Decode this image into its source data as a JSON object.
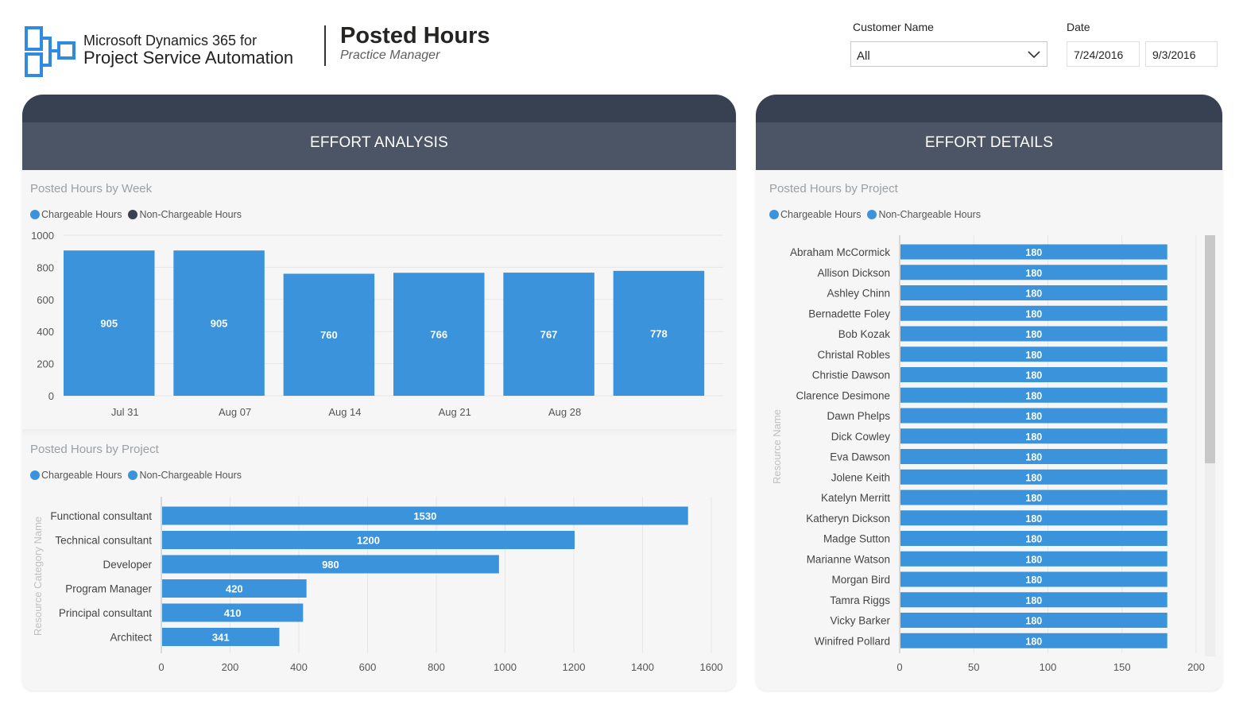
{
  "brand": {
    "line1": "Microsoft Dynamics 365 for",
    "line2": "Project Service Automation"
  },
  "header": {
    "title": "Posted Hours",
    "subtitle": "Practice Manager"
  },
  "filters": {
    "customer_label": "Customer Name",
    "customer_value": "All",
    "date_label": "Date",
    "date_start": "7/24/2016",
    "date_end": "9/3/2016"
  },
  "colors": {
    "chargeable": "#3b93dc",
    "non_chargeable_week": "#374151",
    "non_chargeable_project": "#3b93dc",
    "band_dark": "#374151",
    "band": "#4b5566"
  },
  "panels": {
    "left": {
      "title": "EFFORT ANALYSIS"
    },
    "right": {
      "title": "EFFORT DETAILS"
    }
  },
  "legend": {
    "chargeable": "Chargeable Hours",
    "non_chargeable": "Non-Chargeable Hours"
  },
  "chart_data": [
    {
      "type": "bar",
      "title": "Posted Hours by Week",
      "categories": [
        "Jul 31",
        "Aug 07",
        "Aug 14",
        "Aug 21",
        "Aug 28",
        ""
      ],
      "series": [
        {
          "name": "Chargeable Hours",
          "values": [
            905,
            905,
            760,
            766,
            767,
            778
          ]
        },
        {
          "name": "Non-Chargeable Hours",
          "values": [
            0,
            0,
            0,
            0,
            0,
            0
          ]
        }
      ],
      "ylim": [
        0,
        1000
      ],
      "yticks": [
        0,
        200,
        400,
        600,
        800,
        1000
      ],
      "grid": true,
      "legend": "top-left"
    },
    {
      "type": "bar",
      "orientation": "horizontal",
      "title": "Posted Hours by Project",
      "ylabel": "Resource Category Name",
      "categories": [
        "Functional consultant",
        "Technical consultant",
        "Developer",
        "Program Manager",
        "Principal consultant",
        "Architect"
      ],
      "series": [
        {
          "name": "Chargeable Hours",
          "values": [
            1530,
            1200,
            980,
            420,
            410,
            341
          ]
        },
        {
          "name": "Non-Chargeable Hours",
          "values": [
            0,
            0,
            0,
            0,
            0,
            0
          ]
        }
      ],
      "xlim": [
        0,
        1600
      ],
      "xticks": [
        0,
        200,
        400,
        600,
        800,
        1000,
        1200,
        1400,
        1600
      ],
      "grid": true,
      "legend": "top-left"
    },
    {
      "type": "bar",
      "orientation": "horizontal",
      "title": "Posted Hours by Project",
      "ylabel": "Resource Name",
      "categories": [
        "Abraham McCormick",
        "Allison Dickson",
        "Ashley Chinn",
        "Bernadette Foley",
        "Bob Kozak",
        "Christal Robles",
        "Christie Dawson",
        "Clarence Desimone",
        "Dawn Phelps",
        "Dick Cowley",
        "Eva Dawson",
        "Jolene Keith",
        "Katelyn Merritt",
        "Katheryn Dickson",
        "Madge Sutton",
        "Marianne Watson",
        "Morgan Bird",
        "Tamra Riggs",
        "Vicky Barker",
        "Winifred Pollard"
      ],
      "series": [
        {
          "name": "Chargeable Hours",
          "values": [
            180,
            180,
            180,
            180,
            180,
            180,
            180,
            180,
            180,
            180,
            180,
            180,
            180,
            180,
            180,
            180,
            180,
            180,
            180,
            180
          ]
        },
        {
          "name": "Non-Chargeable Hours",
          "values": [
            0,
            0,
            0,
            0,
            0,
            0,
            0,
            0,
            0,
            0,
            0,
            0,
            0,
            0,
            0,
            0,
            0,
            0,
            0,
            0
          ]
        }
      ],
      "xlim": [
        0,
        200
      ],
      "xticks": [
        0,
        50,
        100,
        150,
        200
      ],
      "grid": true,
      "legend": "top-left"
    }
  ]
}
